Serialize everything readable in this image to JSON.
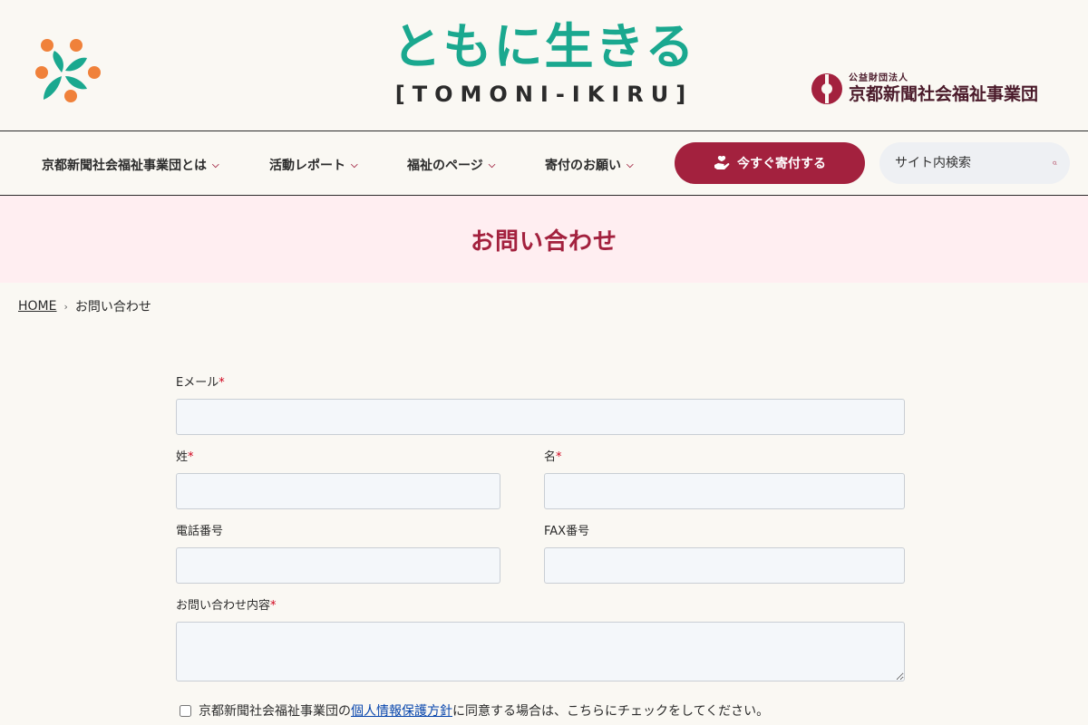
{
  "header": {
    "logo_jp": "ともに生きる",
    "logo_en": "[TOMONI-IKIRU]",
    "org_small": "公益財団法人",
    "org_name": "京都新聞社会福祉事業団"
  },
  "nav": {
    "items": [
      {
        "label": "京都新聞社会福祉事業団とは"
      },
      {
        "label": "活動レポート"
      },
      {
        "label": "福祉のページ"
      },
      {
        "label": "寄付のお願い"
      }
    ],
    "donate_label": "今すぐ寄付する",
    "search_placeholder": "サイト内検索"
  },
  "page": {
    "title": "お問い合わせ",
    "breadcrumb_home": "HOME",
    "breadcrumb_current": "お問い合わせ"
  },
  "form": {
    "email_label": "Eメール",
    "last_name_label": "姓",
    "first_name_label": "名",
    "phone_label": "電話番号",
    "fax_label": "FAX番号",
    "message_label": "お問い合わせ内容",
    "required_mark": "*",
    "agree_prefix": "京都新聞社会福祉事業団の",
    "agree_link": "個人情報保護方針",
    "agree_suffix": "に同意する場合は、こちらにチェックをしてください。"
  },
  "colors": {
    "brand": "#a3213e",
    "teal": "#1aa88f",
    "orange": "#f0813a",
    "banner_bg": "#ffeef1"
  }
}
